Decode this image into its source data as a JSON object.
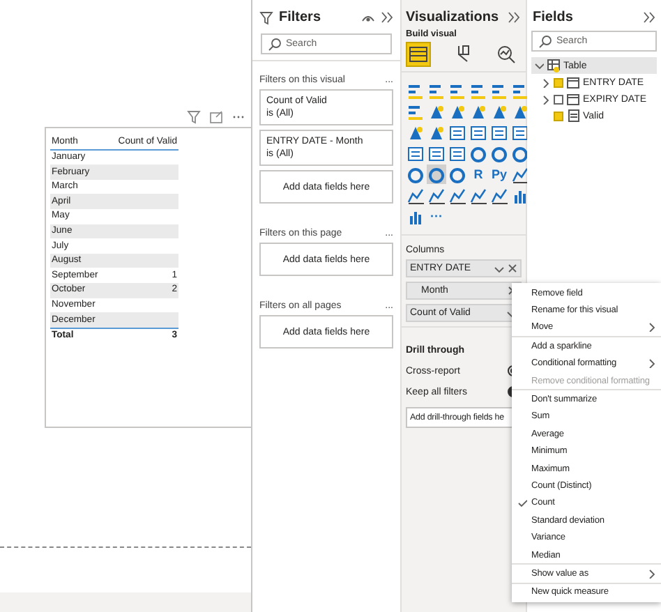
{
  "canvas": {
    "table": {
      "columns": [
        "Month",
        "Count of Valid"
      ],
      "rows": [
        {
          "month": "January"
        },
        {
          "month": "February"
        },
        {
          "month": "March"
        },
        {
          "month": "April"
        },
        {
          "month": "May"
        },
        {
          "month": "June"
        },
        {
          "month": "July"
        },
        {
          "month": "August"
        },
        {
          "month": "September",
          "count": "1"
        },
        {
          "month": "October",
          "count": "2"
        },
        {
          "month": "November"
        },
        {
          "month": "December"
        }
      ],
      "total": {
        "label": "Total",
        "value": "3"
      }
    }
  },
  "filters": {
    "title": "Filters",
    "search": {
      "placeholder": "Search"
    },
    "sections": [
      {
        "title": "Filters on this visual",
        "more": "...",
        "cards": [
          {
            "field": "Count of Valid",
            "value": "is (All)"
          },
          {
            "field": "ENTRY DATE - Month",
            "value": "is (All)"
          }
        ],
        "add": "Add data fields here"
      },
      {
        "title": "Filters on this page",
        "more": "...",
        "add": "Add data fields here"
      },
      {
        "title": "Filters on all pages",
        "more": "...",
        "add": "Add data fields here"
      }
    ]
  },
  "visualizations": {
    "title": "Visualizations",
    "subtitle": "Build visual",
    "build_tabs": [
      {
        "selected": true
      },
      {
        "selected": false
      },
      {
        "selected": false
      }
    ],
    "visual_types": [
      {
        "kind": "icon",
        "selected": false
      },
      {
        "kind": "icon",
        "selected": false
      },
      {
        "kind": "icon",
        "selected": false
      },
      {
        "kind": "icon",
        "selected": false
      },
      {
        "kind": "icon",
        "selected": false
      },
      {
        "kind": "icon",
        "selected": false
      },
      {
        "kind": "icon",
        "selected": false
      },
      {
        "kind": "icon",
        "selected": false
      },
      {
        "kind": "icon",
        "selected": false
      },
      {
        "kind": "icon",
        "selected": false
      },
      {
        "kind": "icon",
        "selected": false
      },
      {
        "kind": "icon",
        "selected": false
      },
      {
        "kind": "icon",
        "selected": false
      },
      {
        "kind": "icon",
        "selected": false
      },
      {
        "kind": "icon",
        "selected": false
      },
      {
        "kind": "icon",
        "selected": false
      },
      {
        "kind": "icon",
        "selected": false
      },
      {
        "kind": "icon",
        "selected": false
      },
      {
        "kind": "icon",
        "selected": false
      },
      {
        "kind": "icon",
        "selected": false
      },
      {
        "kind": "icon",
        "selected": false
      },
      {
        "kind": "icon",
        "selected": false
      },
      {
        "kind": "icon",
        "selected": false
      },
      {
        "kind": "icon",
        "selected": false
      },
      {
        "kind": "icon",
        "selected": false
      },
      {
        "kind": "icon",
        "selected": true
      },
      {
        "kind": "icon",
        "selected": false
      },
      {
        "kind": "text",
        "label": "R",
        "selected": false
      },
      {
        "kind": "text",
        "label": "Py",
        "selected": false
      },
      {
        "kind": "icon",
        "selected": false
      },
      {
        "kind": "icon",
        "selected": false
      },
      {
        "kind": "icon",
        "selected": false
      },
      {
        "kind": "icon",
        "selected": false
      },
      {
        "kind": "icon",
        "selected": false
      },
      {
        "kind": "icon",
        "selected": false
      },
      {
        "kind": "icon",
        "selected": false
      },
      {
        "kind": "icon",
        "selected": false
      },
      {
        "kind": "text",
        "label": "···",
        "selected": false
      }
    ],
    "wells": {
      "title": "Columns",
      "items": [
        {
          "label": "ENTRY DATE",
          "dropdown": true,
          "removable": true,
          "nested": false
        },
        {
          "label": "Month",
          "dropdown": false,
          "removable": true,
          "nested": true
        },
        {
          "label": "Count of Valid",
          "dropdown": true,
          "removable": false,
          "nested": false
        }
      ]
    },
    "drill_through": {
      "title": "Drill through",
      "toggles": [
        {
          "label": "Cross-report",
          "on": false
        },
        {
          "label": "Keep all filters",
          "on": true
        }
      ],
      "add": "Add drill-through fields he"
    }
  },
  "fields": {
    "title": "Fields",
    "search": {
      "placeholder": "Search"
    },
    "tree": [
      {
        "label": "Table",
        "expanded": true,
        "children": [
          {
            "label": "ENTRY DATE",
            "checked": true,
            "expandable": true,
            "kind": "date"
          },
          {
            "label": "EXPIRY DATE",
            "checked": false,
            "expandable": true,
            "kind": "date"
          },
          {
            "label": "Valid",
            "checked": true,
            "expandable": false,
            "kind": "measure"
          }
        ]
      }
    ]
  },
  "context_menu": {
    "groups": [
      [
        {
          "label": "Remove field",
          "disabled": false,
          "checked": false,
          "submenu": false
        },
        {
          "label": "Rename for this visual",
          "disabled": false,
          "checked": false,
          "submenu": false
        },
        {
          "label": "Move",
          "disabled": false,
          "checked": false,
          "submenu": true
        }
      ],
      [
        {
          "label": "Add a sparkline",
          "disabled": false,
          "checked": false,
          "submenu": false
        },
        {
          "label": "Conditional formatting",
          "disabled": false,
          "checked": false,
          "submenu": true
        },
        {
          "label": "Remove conditional formatting",
          "disabled": true,
          "checked": false,
          "submenu": false
        }
      ],
      [
        {
          "label": "Don't summarize",
          "disabled": false,
          "checked": false,
          "submenu": false
        },
        {
          "label": "Sum",
          "disabled": false,
          "checked": false,
          "submenu": false
        },
        {
          "label": "Average",
          "disabled": false,
          "checked": false,
          "submenu": false
        },
        {
          "label": "Minimum",
          "disabled": false,
          "checked": false,
          "submenu": false
        },
        {
          "label": "Maximum",
          "disabled": false,
          "checked": false,
          "submenu": false
        },
        {
          "label": "Count (Distinct)",
          "disabled": false,
          "checked": false,
          "submenu": false
        },
        {
          "label": "Count",
          "disabled": false,
          "checked": true,
          "submenu": false
        },
        {
          "label": "Standard deviation",
          "disabled": false,
          "checked": false,
          "submenu": false
        },
        {
          "label": "Variance",
          "disabled": false,
          "checked": false,
          "submenu": false
        },
        {
          "label": "Median",
          "disabled": false,
          "checked": false,
          "submenu": false
        }
      ],
      [
        {
          "label": "Show value as",
          "disabled": false,
          "checked": false,
          "submenu": true
        }
      ],
      [
        {
          "label": "New quick measure",
          "disabled": false,
          "checked": false,
          "submenu": false
        }
      ]
    ]
  }
}
